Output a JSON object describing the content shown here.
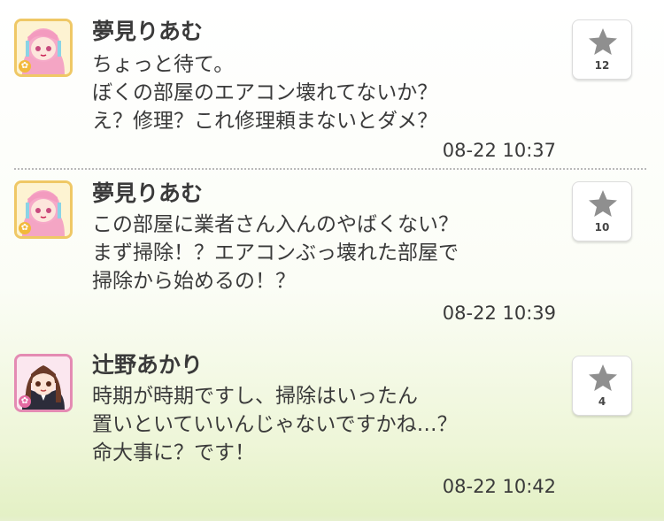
{
  "posts": [
    {
      "author": "夢見りあむ",
      "lines": [
        "ちょっと待て。",
        "ぼくの部屋のエアコン壊れてないか？",
        "え？修理？これ修理頼まないとダメ？"
      ],
      "time": "08-22 10:37",
      "likes": "12",
      "avatar": "pink-hair-girl-avatar"
    },
    {
      "author": "夢見りあむ",
      "lines": [
        "この部屋に業者さん入んのやばくない？",
        "まず掃除！？エアコンぶっ壊れた部屋で",
        "掃除から始めるの！？"
      ],
      "time": "08-22 10:39",
      "likes": "10",
      "avatar": "pink-hair-girl-avatar"
    },
    {
      "author": "辻野あかり",
      "lines": [
        "時期が時期ですし、掃除はいったん",
        "置いといていいんじゃないですかね…？",
        "命大事に？です！"
      ],
      "time": "08-22 10:42",
      "likes": "4",
      "avatar": "brown-hair-girl-avatar"
    }
  ],
  "colors": {
    "text": "#3a3a3a",
    "star": "#8f8f8f",
    "avatar_border_yellow": "#efc866",
    "avatar_border_pink": "#e48bb3"
  },
  "icons": {
    "like": "star-icon",
    "badge": "flower-icon"
  }
}
